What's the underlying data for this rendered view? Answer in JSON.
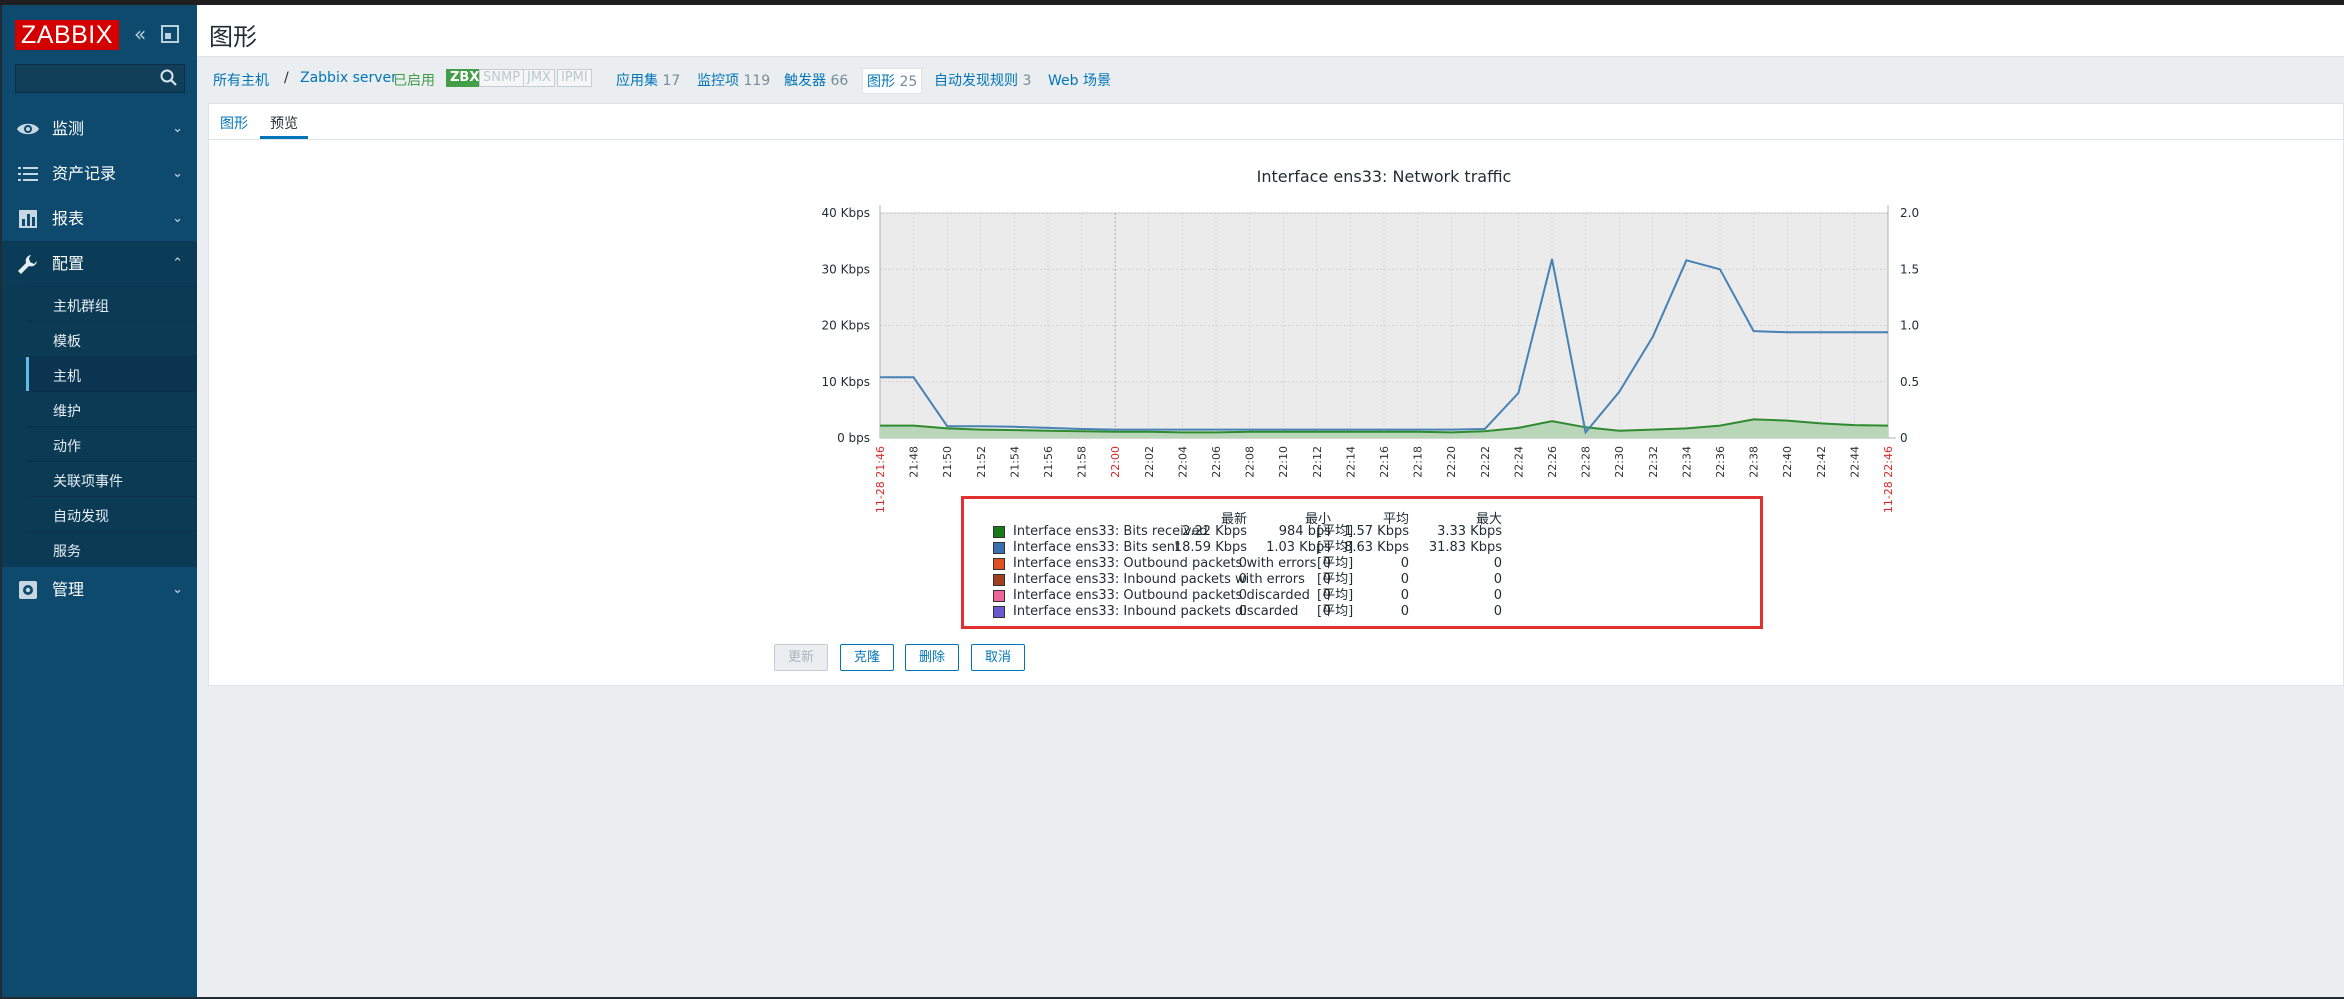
{
  "app": {
    "logo": "ZABBIX"
  },
  "page": {
    "title": "图形"
  },
  "sidebar": {
    "menu": [
      {
        "label": "监测",
        "icon": "eye-icon"
      },
      {
        "label": "资产记录",
        "icon": "list-icon"
      },
      {
        "label": "报表",
        "icon": "bar-chart-icon"
      },
      {
        "label": "配置",
        "icon": "wrench-icon"
      },
      {
        "label": "管理",
        "icon": "gear-icon"
      }
    ],
    "submenu": [
      "主机群组",
      "模板",
      "主机",
      "维护",
      "动作",
      "关联项事件",
      "自动发现",
      "服务"
    ]
  },
  "filter": {
    "all_hosts": "所有主机",
    "separator": "/",
    "host": "Zabbix server",
    "status": "已启用",
    "badges": [
      "ZBX",
      "SNMP",
      "JMX",
      "IPMI"
    ],
    "apps": {
      "label": "应用集",
      "count": "17"
    },
    "items": {
      "label": "监控项",
      "count": "119"
    },
    "triggers": {
      "label": "触发器",
      "count": "66"
    },
    "graphs": {
      "label": "图形",
      "count": "25"
    },
    "discovery": {
      "label": "自动发现规则",
      "count": "3"
    },
    "web": "Web 场景"
  },
  "tabs": [
    "图形",
    "预览"
  ],
  "chart_data": {
    "type": "line",
    "title": "Interface ens33: Network traffic",
    "y_left_ticks": [
      "0 bps",
      "10 Kbps",
      "20 Kbps",
      "30 Kbps",
      "40 Kbps"
    ],
    "y_right_ticks": [
      "0",
      "0.5",
      "1.0",
      "1.5",
      "2.0"
    ],
    "ylim": [
      0,
      40
    ],
    "x_start_label": "11-28 21:46",
    "x_end_label": "11-28 22:46",
    "x_ticks": [
      "21:48",
      "21:50",
      "21:52",
      "21:54",
      "21:56",
      "21:58",
      "22:00",
      "22:02",
      "22:04",
      "22:06",
      "22:08",
      "22:10",
      "22:12",
      "22:14",
      "22:16",
      "22:18",
      "22:20",
      "22:22",
      "22:24",
      "22:26",
      "22:28",
      "22:30",
      "22:32",
      "22:34",
      "22:36",
      "22:38",
      "22:40",
      "22:42",
      "22:44"
    ],
    "series": [
      {
        "name": "Interface ens33: Bits received",
        "color": "#2e8b2e",
        "x": [
          "21:46",
          "21:48",
          "21:50",
          "21:52",
          "21:54",
          "21:56",
          "21:58",
          "22:00",
          "22:02",
          "22:04",
          "22:06",
          "22:08",
          "22:10",
          "22:12",
          "22:14",
          "22:16",
          "22:18",
          "22:20",
          "22:22",
          "22:24",
          "22:26",
          "22:28",
          "22:30",
          "22:32",
          "22:34",
          "22:36",
          "22:38",
          "22:40",
          "22:42",
          "22:44",
          "22:46"
        ],
        "values": [
          2.2,
          2.2,
          1.7,
          1.5,
          1.4,
          1.3,
          1.2,
          1.1,
          1.1,
          1.0,
          1.0,
          1.1,
          1.1,
          1.1,
          1.1,
          1.1,
          1.1,
          1.0,
          1.2,
          1.8,
          3.0,
          1.9,
          1.3,
          1.5,
          1.7,
          2.2,
          3.3,
          3.1,
          2.6,
          2.3,
          2.2
        ]
      },
      {
        "name": "Interface ens33: Bits sent",
        "color": "#4682b4",
        "x": [
          "21:46",
          "21:48",
          "21:50",
          "21:52",
          "21:54",
          "21:56",
          "21:58",
          "22:00",
          "22:02",
          "22:04",
          "22:06",
          "22:08",
          "22:10",
          "22:12",
          "22:14",
          "22:16",
          "22:18",
          "22:20",
          "22:22",
          "22:24",
          "22:26",
          "22:28",
          "22:30",
          "22:32",
          "22:34",
          "22:36",
          "22:38",
          "22:40",
          "22:42",
          "22:44",
          "22:46"
        ],
        "values": [
          10.8,
          10.8,
          2.1,
          2.1,
          2.0,
          1.8,
          1.6,
          1.5,
          1.5,
          1.5,
          1.5,
          1.5,
          1.5,
          1.5,
          1.5,
          1.5,
          1.5,
          1.5,
          1.6,
          8.0,
          31.8,
          1.0,
          8.2,
          18.0,
          31.6,
          30.0,
          19.0,
          18.8,
          18.8,
          18.8,
          18.8
        ]
      }
    ]
  },
  "legend": {
    "headers": [
      "最新",
      "最小",
      "平均",
      "最大"
    ],
    "rows": [
      {
        "color": "#1a7a1a",
        "name": "Interface ens33: Bits received",
        "func": "[平均]",
        "values": [
          "2.22 Kbps",
          "984 bps",
          "1.57 Kbps",
          "3.33 Kbps"
        ]
      },
      {
        "color": "#3a6fb0",
        "name": "Interface ens33: Bits sent",
        "func": "[平均]",
        "values": [
          "18.59 Kbps",
          "1.03 Kbps",
          "8.63 Kbps",
          "31.83 Kbps"
        ]
      },
      {
        "color": "#e05020",
        "name": "Interface ens33: Outbound packets with errors",
        "func": "[平均]",
        "values": [
          "0",
          "0",
          "0",
          "0"
        ]
      },
      {
        "color": "#a04020",
        "name": "Interface ens33: Inbound packets with errors",
        "func": "[平均]",
        "values": [
          "0",
          "0",
          "0",
          "0"
        ]
      },
      {
        "color": "#ee6699",
        "name": "Interface ens33: Outbound packets discarded",
        "func": "[平均]",
        "values": [
          "0",
          "0",
          "0",
          "0"
        ]
      },
      {
        "color": "#6a5acd",
        "name": "Interface ens33: Inbound packets discarded",
        "func": "[平均]",
        "values": [
          "0",
          "0",
          "0",
          "0"
        ]
      }
    ]
  },
  "buttons": {
    "update": "更新",
    "clone": "克隆",
    "delete": "删除",
    "cancel": "取消"
  }
}
